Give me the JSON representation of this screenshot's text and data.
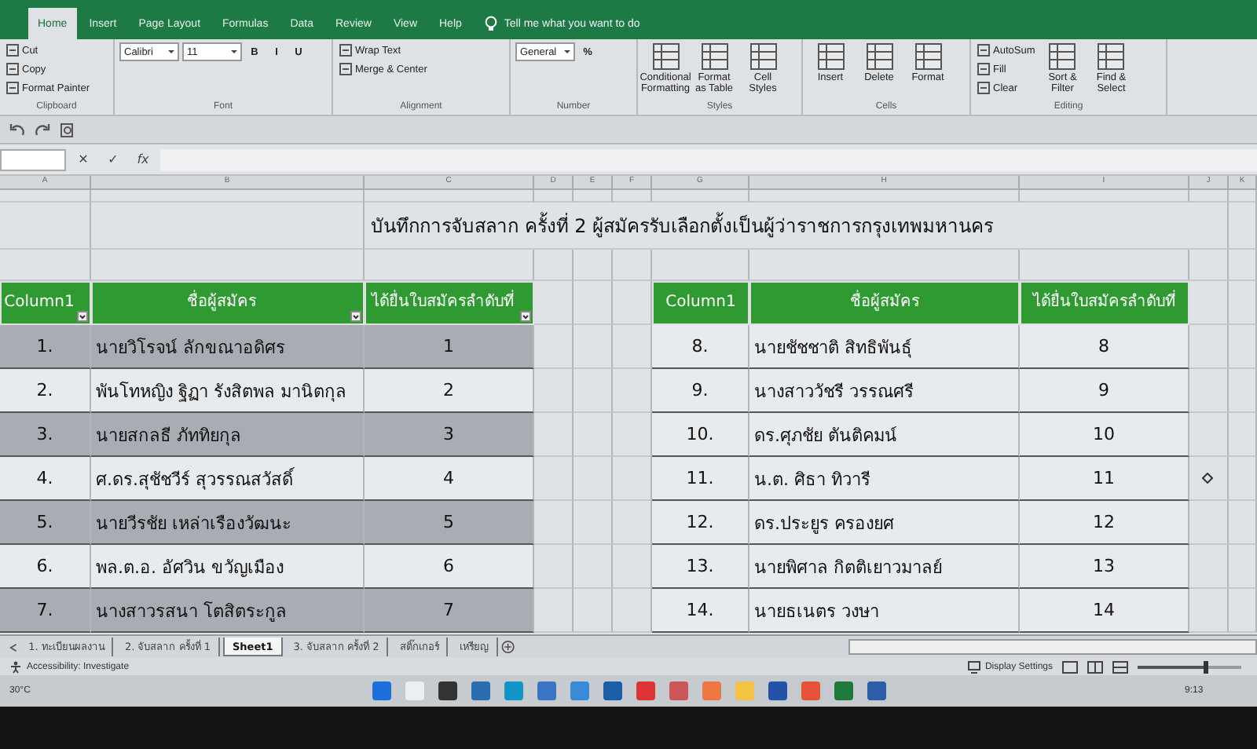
{
  "ribbon_tabs": [
    {
      "label": "Home",
      "selected": true
    },
    {
      "label": "Insert",
      "selected": false
    },
    {
      "label": "Page Layout",
      "selected": false
    },
    {
      "label": "Formulas",
      "selected": false
    },
    {
      "label": "Data",
      "selected": false
    },
    {
      "label": "Review",
      "selected": false
    },
    {
      "label": "View",
      "selected": false
    },
    {
      "label": "Help",
      "selected": false
    }
  ],
  "tell_me": "Tell me what you want to do",
  "ribbon_groups": [
    {
      "label": "Clipboard",
      "commands": [
        {
          "kind": "small",
          "label": "Cut"
        },
        {
          "kind": "small",
          "label": "Copy"
        },
        {
          "kind": "small",
          "label": "Format Painter"
        }
      ]
    },
    {
      "label": "Font",
      "commands": [
        {
          "kind": "dropdown",
          "label": "Calibri"
        },
        {
          "kind": "dropdown",
          "label": "11"
        },
        {
          "kind": "glyph",
          "label": "B"
        },
        {
          "kind": "glyph",
          "label": "I"
        },
        {
          "kind": "glyph",
          "label": "U"
        }
      ]
    },
    {
      "label": "Alignment",
      "commands": [
        {
          "kind": "small",
          "label": "Wrap Text"
        },
        {
          "kind": "small",
          "label": "Merge & Center"
        }
      ]
    },
    {
      "label": "Number",
      "commands": [
        {
          "kind": "dropdown",
          "label": "General"
        },
        {
          "kind": "glyph",
          "label": "%"
        }
      ]
    },
    {
      "label": "Styles",
      "commands": [
        {
          "kind": "large",
          "label": "Conditional Formatting"
        },
        {
          "kind": "large",
          "label": "Format as Table"
        },
        {
          "kind": "large",
          "label": "Cell Styles"
        }
      ]
    },
    {
      "label": "Cells",
      "commands": [
        {
          "kind": "large",
          "label": "Insert"
        },
        {
          "kind": "large",
          "label": "Delete"
        },
        {
          "kind": "large",
          "label": "Format"
        }
      ]
    },
    {
      "label": "Editing",
      "commands": [
        {
          "kind": "small",
          "label": "AutoSum"
        },
        {
          "kind": "small",
          "label": "Fill"
        },
        {
          "kind": "small",
          "label": "Clear"
        },
        {
          "kind": "large",
          "label": "Sort & Filter"
        },
        {
          "kind": "large",
          "label": "Find & Select"
        }
      ]
    }
  ],
  "formula_bar": {
    "cancel": "✕",
    "enter": "✓",
    "function": "fx"
  },
  "column_headers": [
    "A",
    "B",
    "C",
    "D",
    "E",
    "F",
    "G",
    "H",
    "I",
    "J",
    "K"
  ],
  "sheet_title": "บันทึกการจับสลาก  ครั้งที่ 2 ผู้สมัครรับเลือกตั้งเป็นผู้ว่าราชการกรุงเทพมหานคร",
  "tables": [
    {
      "filter_buttons": true,
      "columns": [
        "Column1",
        "ชื่อผู้สมัคร",
        "ได้ยื่นใบสมัครลำดับที่"
      ],
      "rows": [
        {
          "no": "1.",
          "name": "นายวิโรจน์ ลักขณาอดิศร",
          "order": "1",
          "shaded": true
        },
        {
          "no": "2.",
          "name": "พันโทหญิง ฐิฏา รังสิตพล มานิตกุล",
          "order": "2",
          "shaded": false
        },
        {
          "no": "3.",
          "name": "นายสกลธี ภัททิยกุล",
          "order": "3",
          "shaded": true
        },
        {
          "no": "4.",
          "name": "ศ.ดร.สุชัชวีร์ สุวรรณสวัสดิ์",
          "order": "4",
          "shaded": false
        },
        {
          "no": "5.",
          "name": "นายวีรชัย เหล่าเรืองวัฒนะ",
          "order": "5",
          "shaded": true
        },
        {
          "no": "6.",
          "name": "พล.ต.อ. อัศวิน  ขวัญเมือง",
          "order": "6",
          "shaded": false
        },
        {
          "no": "7.",
          "name": "นางสาวรสนา โตสิตระกูล",
          "order": "7",
          "shaded": true
        }
      ]
    },
    {
      "filter_buttons": false,
      "columns": [
        "Column1",
        "ชื่อผู้สมัคร",
        "ได้ยื่นใบสมัครลำดับที่"
      ],
      "rows": [
        {
          "no": "8.",
          "name": "นายชัชชาติ  สิทธิพันธุ์",
          "order": "8",
          "shaded": false
        },
        {
          "no": "9.",
          "name": "นางสาววัชรี วรรณศรี",
          "order": "9",
          "shaded": false
        },
        {
          "no": "10.",
          "name": "ดร.ศุภชัย ตันติคมน์",
          "order": "10",
          "shaded": false
        },
        {
          "no": "11.",
          "name": "น.ต. ศิธา  ทิวารี",
          "order": "11",
          "shaded": false
        },
        {
          "no": "12.",
          "name": "ดร.ประยูร ครองยศ",
          "order": "12",
          "shaded": false
        },
        {
          "no": "13.",
          "name": "นายพิศาล กิตติเยาวมาลย์",
          "order": "13",
          "shaded": false
        },
        {
          "no": "14.",
          "name": "นายธเนตร วงษา",
          "order": "14",
          "shaded": false
        }
      ]
    }
  ],
  "sheet_tabs": [
    {
      "label": "1. ทะเบียนผลงาน",
      "selected": false
    },
    {
      "label": "2. จับสลาก ครั้งที่ 1",
      "selected": false
    },
    {
      "label": "Sheet1",
      "selected": true
    },
    {
      "label": "3. จับสลาก ครั้งที่ 2",
      "selected": false
    },
    {
      "label": "สติ๊กเกอร์",
      "selected": false
    },
    {
      "label": "เหรียญ",
      "selected": false
    }
  ],
  "status_bar": {
    "accessibility": "Accessibility: Investigate",
    "display_settings": "Display Settings",
    "zoom_slider": {
      "level": 0.65
    }
  },
  "taskbar": {
    "weather": "30°C",
    "clock": "9:13"
  }
}
